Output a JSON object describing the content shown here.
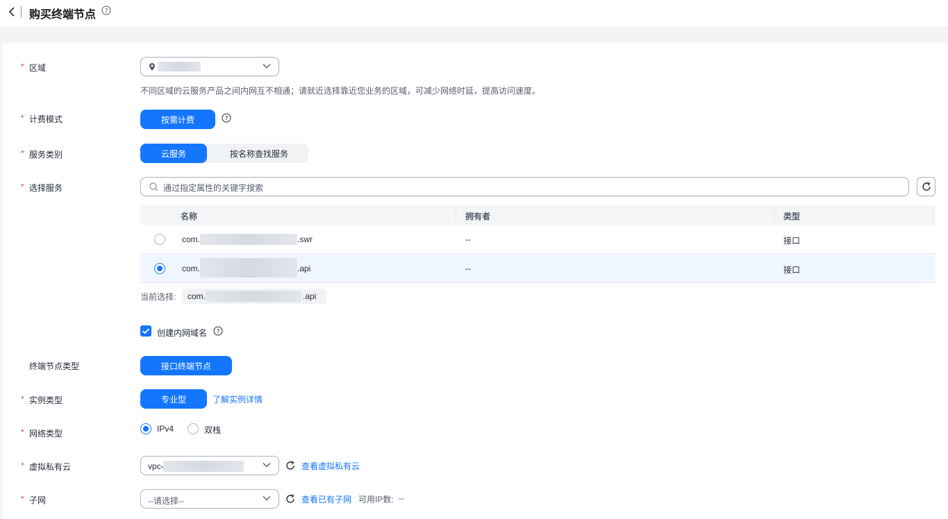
{
  "header": {
    "title": "购买终端节点"
  },
  "form": {
    "region": {
      "label": "区域",
      "hint": "不同区域的云服务产品之间内网互不相通；请就近选择靠近您业务的区域，可减少网络时延，提高访问速度。"
    },
    "billing": {
      "label": "计费模式",
      "option": "按需计费"
    },
    "service_category": {
      "label": "服务类别",
      "options": [
        "云服务",
        "按名称查找服务"
      ],
      "selected": "云服务"
    },
    "select_service": {
      "label": "选择服务",
      "search_placeholder": "通过指定属性的关键字搜索",
      "columns": [
        "名称",
        "拥有者",
        "类型"
      ],
      "rows": [
        {
          "name_prefix": "com.",
          "name_suffix": ".swr",
          "owner": "--",
          "type": "接口",
          "selected": false
        },
        {
          "name_prefix": "com.",
          "name_suffix": ".api",
          "owner": "--",
          "type": "接口",
          "selected": true
        }
      ],
      "current_label": "当前选择:",
      "current_prefix": "com.",
      "current_suffix": ".api"
    },
    "private_dns": {
      "label": "创建内网域名",
      "checked": true
    },
    "endpoint_type": {
      "label": "终端节点类型",
      "option": "接口终端节点"
    },
    "instance_type": {
      "label": "实例类型",
      "option": "专业型",
      "link": "了解实例详情"
    },
    "network_type": {
      "label": "网络类型",
      "options": [
        "IPv4",
        "双栈"
      ],
      "selected": "IPv4"
    },
    "vpc": {
      "label": "虚拟私有云",
      "value_prefix": "vpc-",
      "link": "查看虚拟私有云"
    },
    "subnet": {
      "label": "子网",
      "placeholder": "--请选择--",
      "link": "查看已有子网",
      "available_ip_label": "可用IP数:",
      "available_ip_value": "--"
    }
  },
  "colors": {
    "primary": "#1476ff",
    "required": "#e5484d"
  }
}
